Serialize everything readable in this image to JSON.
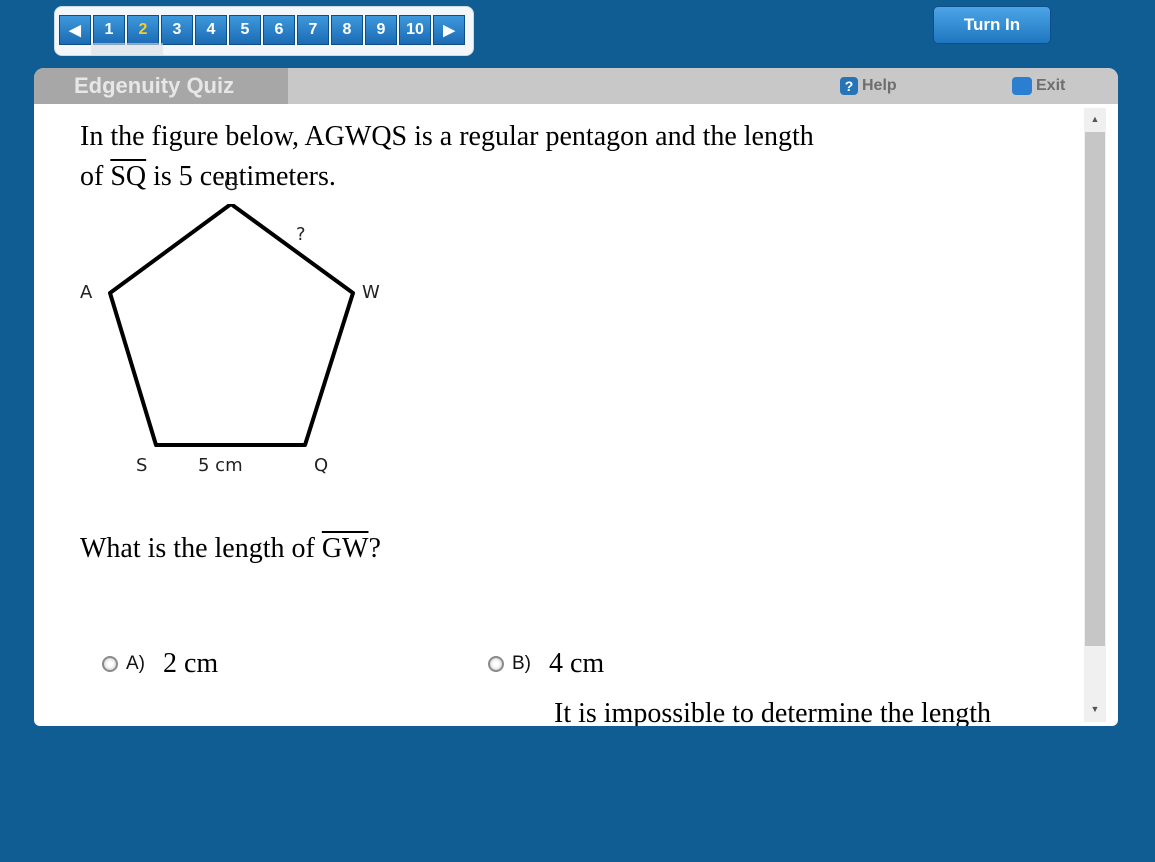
{
  "nav": {
    "prev_icon": "◀",
    "next_icon": "▶",
    "questions": [
      "1",
      "2",
      "3",
      "4",
      "5",
      "6",
      "7",
      "8",
      "9",
      "10"
    ],
    "current": "2"
  },
  "toolbar": {
    "turn_in_label": "Turn In",
    "title": "Edgenuity Quiz",
    "help_label": "Help",
    "help_icon": "?",
    "exit_label": "Exit"
  },
  "question": {
    "line1": "In the figure below, AGWQS is a regular pentagon and the length",
    "line2_prefix": "of ",
    "line2_segment": "SQ",
    "line2_suffix": " is 5 centimeters.",
    "ask_prefix": "What is the length of ",
    "ask_segment": "GW",
    "ask_suffix": "?"
  },
  "figure": {
    "vertex_labels": {
      "G": "G",
      "A": "A",
      "W": "W",
      "S": "S",
      "Q": "Q"
    },
    "unknown_label": "?",
    "side_label": "5 cm"
  },
  "choices": [
    {
      "letter": "A)",
      "text": "2 cm"
    },
    {
      "letter": "B)",
      "text": "4 cm"
    },
    {
      "letter": "",
      "text": "It is impossible to determine the length"
    }
  ],
  "colors": {
    "background": "#105d93",
    "nav_button": "#2a80c8",
    "current_number": "#f6cc2a",
    "title_bar": "#c8c8c8"
  }
}
